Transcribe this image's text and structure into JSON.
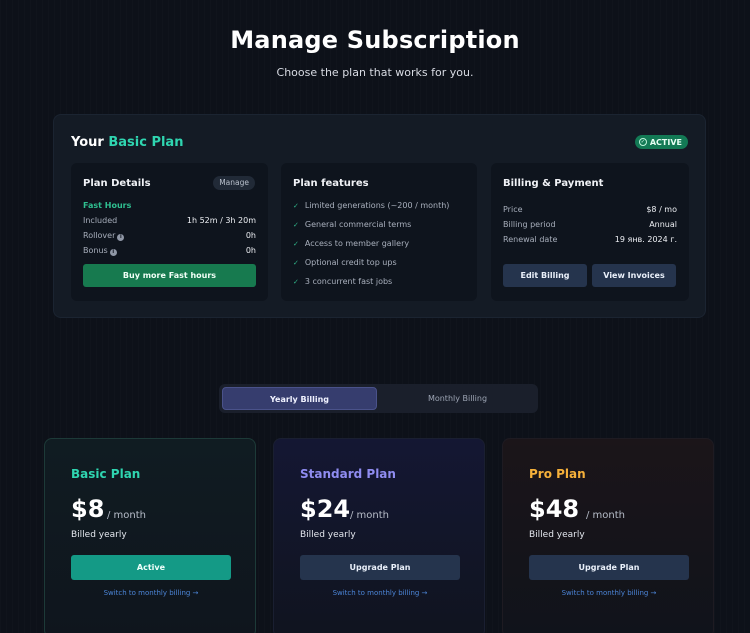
{
  "header": {
    "title": "Manage Subscription",
    "subtitle": "Choose the plan that works for you."
  },
  "current_plan": {
    "title_prefix": "Your ",
    "plan_name": "Basic Plan",
    "status_badge": "ACTIVE",
    "status_color": "#137a55",
    "accent_color": "#2fd5b0",
    "plan_details": {
      "title": "Plan Details",
      "manage_label": "Manage",
      "fast_hours_label": "Fast Hours",
      "rows": [
        {
          "label": "Included",
          "value": "1h 52m / 3h 20m",
          "info": false
        },
        {
          "label": "Rollover",
          "value": "0h",
          "info": true
        },
        {
          "label": "Bonus",
          "value": "0h",
          "info": true
        }
      ],
      "buy_button": "Buy more Fast hours"
    },
    "plan_features": {
      "title": "Plan features",
      "items": [
        "Limited generations (~200 / month)",
        "General commercial terms",
        "Access to member gallery",
        "Optional credit top ups",
        "3 concurrent fast jobs"
      ]
    },
    "billing": {
      "title": "Billing & Payment",
      "rows": [
        {
          "label": "Price",
          "value": "$8 / mo"
        },
        {
          "label": "Billing period",
          "value": "Annual"
        },
        {
          "label": "Renewal date",
          "value": "19 янв. 2024 г."
        }
      ],
      "edit_button": "Edit Billing",
      "invoices_button": "View Invoices"
    }
  },
  "billing_toggle": {
    "options": [
      "Yearly Billing",
      "Monthly Billing"
    ],
    "selected": "Yearly Billing"
  },
  "plans": [
    {
      "name": "Basic Plan",
      "color": "#2fd5b0",
      "price": "$8",
      "period": "/ month",
      "billed": "Billed yearly",
      "button": "Active",
      "link": "Switch to monthly billing →"
    },
    {
      "name": "Standard Plan",
      "color": "#8f8cf0",
      "price": "$24",
      "period": "/ month",
      "billed": "Billed yearly",
      "button": "Upgrade Plan",
      "link": "Switch to monthly billing →"
    },
    {
      "name": "Pro Plan",
      "color": "#f5b03a",
      "price": "$48",
      "period": "/ month",
      "billed": "Billed yearly",
      "button": "Upgrade Plan",
      "link": "Switch to monthly billing →"
    }
  ]
}
